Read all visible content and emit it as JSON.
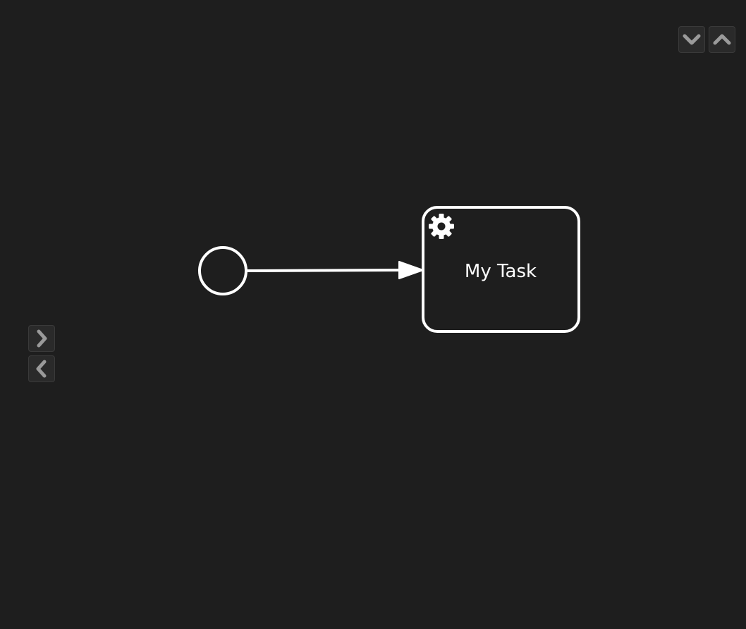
{
  "diagram": {
    "task": {
      "label": "My Task",
      "marker_icon": "gear-icon"
    },
    "start_event": {
      "icon": "circle"
    },
    "sequence_flow": {
      "icon": "arrow"
    }
  },
  "controls": {
    "collapse_icon": "chevron-down-icon",
    "expand_icon": "chevron-up-icon",
    "next_icon": "chevron-right-icon",
    "prev_icon": "chevron-left-icon"
  },
  "colors": {
    "background": "#1e1e1e",
    "stroke": "#ffffff",
    "button_bg": "#2a2a2a",
    "button_icon": "#9a9a9a"
  }
}
